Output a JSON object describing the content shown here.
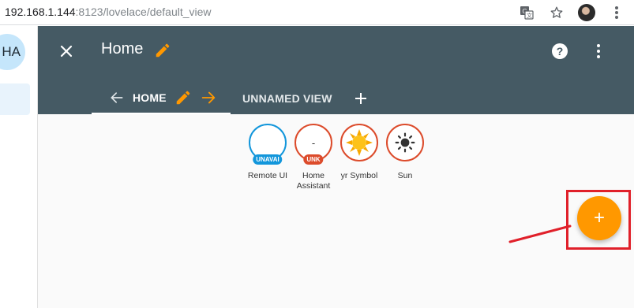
{
  "browser": {
    "url_host": "192.168.1.144",
    "url_path": ":8123/lovelace/default_view",
    "icons": [
      "translate-icon",
      "star-icon",
      "profile-avatar",
      "more-vert-icon"
    ]
  },
  "sidebar": {
    "badge_text": "HA"
  },
  "header": {
    "title": "Home",
    "tabs": [
      {
        "label": "HOME",
        "active": true
      },
      {
        "label": "UNNAMED VIEW",
        "active": false
      }
    ]
  },
  "badges": [
    {
      "value": "",
      "tag": "UNAVAI",
      "label_line1": "Remote UI",
      "label_line2": "",
      "color": "#1296db"
    },
    {
      "value": "-",
      "tag": "UNK",
      "label_line1": "Home",
      "label_line2": "Assistant",
      "color": "#dc4b2b"
    },
    {
      "value": "",
      "tag": "",
      "label_line1": "yr Symbol",
      "label_line2": "",
      "color": "#dc4b2b",
      "icon": "sun-weather-icon"
    },
    {
      "value": "",
      "tag": "",
      "label_line1": "Sun",
      "label_line2": "",
      "color": "#dc4b2b",
      "icon": "sun-icon"
    }
  ],
  "fab": {
    "label": "+",
    "color": "#ff9800"
  },
  "colors": {
    "header_bg": "#455a64",
    "accent": "#ff9800",
    "highlight": "#e0202a"
  }
}
